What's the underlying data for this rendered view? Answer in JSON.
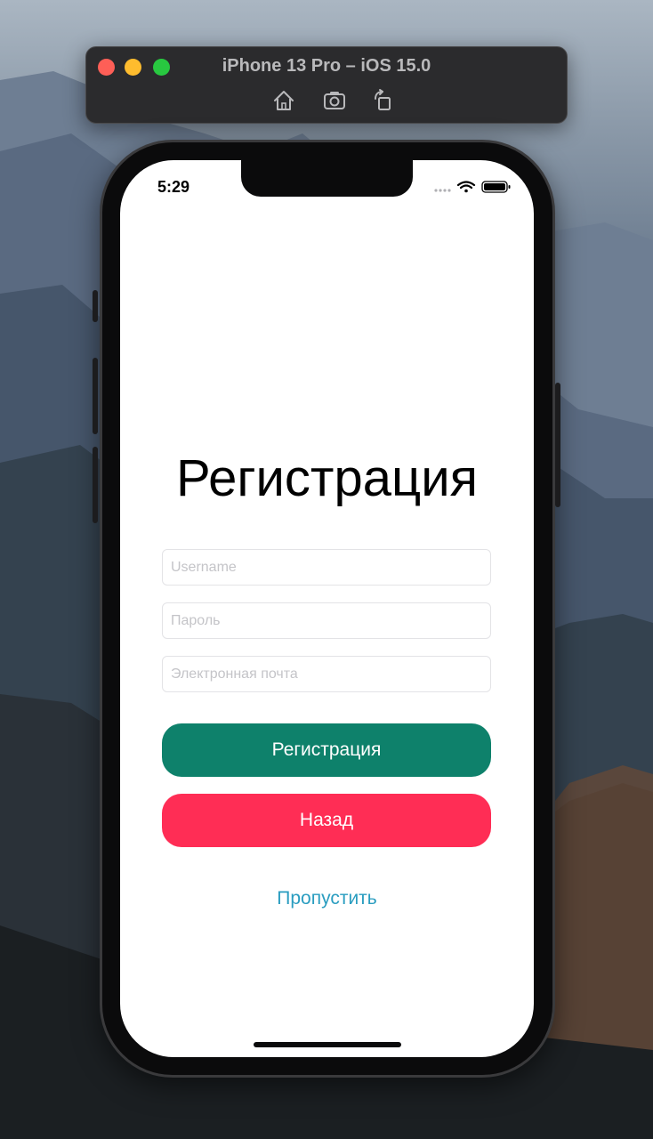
{
  "simulator": {
    "title": "iPhone 13 Pro – iOS 15.0",
    "tools": [
      "home-icon",
      "screenshot-icon",
      "rotate-icon"
    ]
  },
  "status_bar": {
    "time": "5:29",
    "icons": [
      "signal-dots-icon",
      "wifi-icon",
      "battery-icon"
    ]
  },
  "screen": {
    "title": "Регистрация",
    "fields": {
      "username_placeholder": "Username",
      "password_placeholder": "Пароль",
      "email_placeholder": "Электронная почта"
    },
    "buttons": {
      "register": "Регистрация",
      "back": "Назад",
      "skip": "Пропустить"
    }
  },
  "colors": {
    "register_button": "#0e816b",
    "back_button": "#ff2d55",
    "skip_link": "#2a9dc0"
  }
}
